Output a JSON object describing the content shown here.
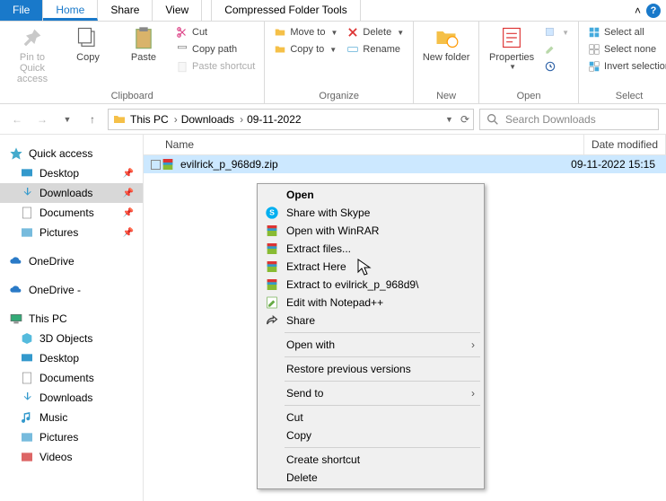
{
  "tabs": {
    "file": "File",
    "home": "Home",
    "share": "Share",
    "view": "View",
    "tools": "Compressed Folder Tools"
  },
  "ribbon": {
    "clipboard": {
      "label": "Clipboard",
      "pin": "Pin to Quick access",
      "copy": "Copy",
      "paste": "Paste",
      "cut": "Cut",
      "copy_path": "Copy path",
      "paste_shortcut": "Paste shortcut"
    },
    "organize": {
      "label": "Organize",
      "move": "Move to",
      "copy": "Copy to",
      "delete": "Delete",
      "rename": "Rename"
    },
    "new": {
      "label": "New",
      "folder": "New folder"
    },
    "open": {
      "label": "Open",
      "properties": "Properties"
    },
    "select": {
      "label": "Select",
      "all": "Select all",
      "none": "Select none",
      "invert": "Invert selection"
    }
  },
  "breadcrumb": [
    "This PC",
    "Downloads",
    "09-11-2022"
  ],
  "search_placeholder": "Search Downloads",
  "nav": {
    "quick": "Quick access",
    "quick_items": [
      "Desktop",
      "Downloads",
      "Documents",
      "Pictures"
    ],
    "onedrive1": "OneDrive",
    "onedrive2": "OneDrive -",
    "thispc": "This PC",
    "pc_items": [
      "3D Objects",
      "Desktop",
      "Documents",
      "Downloads",
      "Music",
      "Pictures",
      "Videos"
    ]
  },
  "columns": {
    "name": "Name",
    "date": "Date modified"
  },
  "file": {
    "name": "evilrick_p_968d9.zip",
    "date": "09-11-2022 15:15"
  },
  "ctx": {
    "open": "Open",
    "skype": "Share with Skype",
    "open_winrar": "Open with WinRAR",
    "extract_files": "Extract files...",
    "extract_here": "Extract Here",
    "extract_to": "Extract to evilrick_p_968d9\\",
    "notepad": "Edit with Notepad++",
    "share": "Share",
    "open_with": "Open with",
    "restore": "Restore previous versions",
    "send_to": "Send to",
    "cut": "Cut",
    "copy": "Copy",
    "shortcut": "Create shortcut",
    "delete": "Delete"
  },
  "colors": {
    "accent": "#1979ca",
    "highlight": "#e11"
  }
}
